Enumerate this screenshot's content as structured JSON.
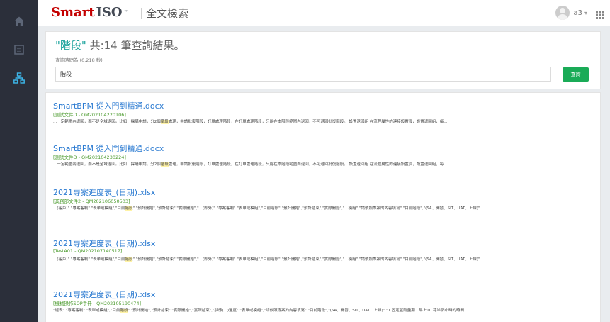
{
  "app": {
    "logo_brand": "Smart",
    "logo_product": "ISO",
    "logo_tm": "™",
    "page_title": "全文檢索"
  },
  "user": {
    "name": "a3",
    "caret": "▾"
  },
  "sidebar": {
    "items": [
      {
        "icon": "home-icon"
      },
      {
        "icon": "document-icon"
      },
      {
        "icon": "sitemap-icon",
        "active": true
      }
    ]
  },
  "search": {
    "keyword": "\"階段\"",
    "summary": " 共:14 筆查詢結果。",
    "timing": "查詢時間為 (0.218 秒)",
    "input_value": "階段",
    "button_label": "查詢"
  },
  "results": [
    {
      "filename": "SmartBPM 從入門到精通.docx",
      "code": "[測試文件D - QM202104220106]",
      "snippet_pre": "...一定範圍內退回，而不是全域退回。比如，採購申請，分2個",
      "snippet_hl": "階段",
      "snippet_post": "處理，申請批復階段，訂單處理階段，在訂單處理階段，只能在本階段範圍內退回，不可退回批復階段。 設置退回組 在流程屬性的連接設置頁，設置退回組，每..."
    },
    {
      "filename": "SmartBPM 從入門到精通.docx",
      "code": "[測試文件D - QM202104230224]",
      "snippet_pre": "...一定範圍內退回，而不是全域退回。比如，採購申請，分2個",
      "snippet_hl": "階段",
      "snippet_post": "處理，申請批復階段，訂單處理階段，在訂單處理階段，只能在本階段範圍內退回，不可退回批復階段。 設置退回組 在流程屬性的連接設置頁，設置退回組，每..."
    },
    {
      "filename": "2021專案進度表_(日期).xlsx",
      "code": "[業務部文件2 - QM202106050503]",
      "snippet_pre": "...(客戶)\" \"專案客制\" \"表單或模組\",\"目前",
      "snippet_hl": "階段",
      "snippet_post": "\",\"預計開始\",\"預計結束\",\"實際開始\",\"...(即外)\" \"專案客制\" \"表單或模組\",\"目前階段\",\"預計開始\",\"預計結束\",\"實際開始\",\"...模組\",\"請依照專案的內容填寫\" \"目前階段\",\"(SA、開發、SIT、UAT、上線)\"..."
    },
    {
      "filename": "2021專案進度表_(日期).xlsx",
      "code": "[TestA01 - QM202107140517]",
      "snippet_pre": "...(客戶)\" \"專案客制\" \"表單或模組\",\"目前",
      "snippet_hl": "階段",
      "snippet_post": "\",\"預計開始\",\"預計結束\",\"實際開始\",\"...(即外)\" \"專案客制\" \"表單或模組\",\"目前階段\",\"預計開始\",\"預計結束\",\"實際開始\",\"...模組\",\"請依照專案的內容填寫\" \"目前階段\",\"(SA、開發、SIT、UAT、上線)\"..."
    },
    {
      "filename": "2021專案進度表_(日期).xlsx",
      "code": "[機械操作SOP手冊 - QM202105190474]",
      "snippet_pre": "\"經表\" \"專案客制\" \"表單或模組\",\"目前",
      "snippet_hl": "階段",
      "snippet_post": "\",\"預計開始\",\"預計結束\",\"實際開始\",\"實際結束\",\"狀態(...)進度\" \"表單或模組\",\"請依照專案的內容填寫\" \"目前階段\",\"(SA、開發、SIT、UAT、上線)\" \"1.固定置剛量期二早上10.花半個小時的時間..."
    }
  ]
}
